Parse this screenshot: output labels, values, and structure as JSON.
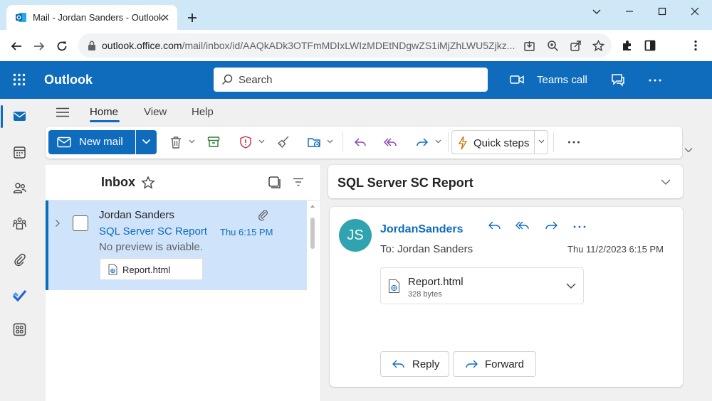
{
  "browser": {
    "tab_title": "Mail - Jordan Sanders - Outlook",
    "url_host": "outlook.office.com",
    "url_path": "/mail/inbox/id/AAQkADk3OTFmMDIxLWIzMDEtNDgwZS1iMjZhLWU5Zjkz..."
  },
  "header": {
    "brand": "Outlook",
    "search_placeholder": "Search",
    "teams_call_label": "Teams call"
  },
  "menu": {
    "tabs": [
      {
        "label": "Home",
        "active": true
      },
      {
        "label": "View",
        "active": false
      },
      {
        "label": "Help",
        "active": false
      }
    ]
  },
  "ribbon": {
    "new_mail_label": "New mail",
    "quick_steps_label": "Quick steps"
  },
  "message_list": {
    "folder_title": "Inbox",
    "messages": [
      {
        "sender": "Jordan Sanders",
        "subject": "SQL Server SC Report",
        "time": "Thu 6:15 PM",
        "preview": "No preview is aviable.",
        "attachment": "Report.html",
        "selected": true
      }
    ]
  },
  "reading_pane": {
    "subject": "SQL Server SC Report",
    "avatar_initials": "JS",
    "from": "JordanSanders",
    "to": "To: Jordan Sanders",
    "date": "Thu 11/2/2023 6:15 PM",
    "attachment_name": "Report.html",
    "attachment_size": "328 bytes",
    "reply_label": "Reply",
    "forward_label": "Forward"
  },
  "colors": {
    "brand_blue": "#0f6cbd",
    "selected_row": "#cfe4fa",
    "avatar": "#2fa3b0",
    "tabstrip": "#cfe8f7"
  }
}
